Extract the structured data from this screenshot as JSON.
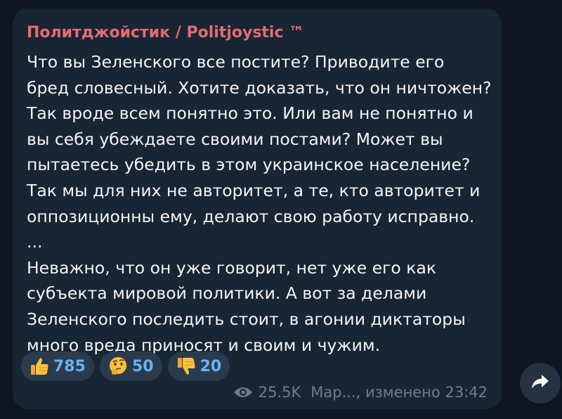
{
  "message": {
    "author": "Политджойстик / Politjoystic ™",
    "lines": [
      "Что вы Зеленского все постите? Приводите его",
      "бред словесный. Хотите доказать, что он ничтожен?",
      "Так вроде всем понятно это. Или вам не понятно и",
      "вы себя убеждаете своими постами? Может вы",
      "пытаетесь убедить в этом украинское население?",
      "Так мы для них не авторитет, а те, кто авторитет и",
      "оппозиционны ему, делают свою работу исправно.",
      "...",
      "Неважно, что он уже говорит, нет уже его как",
      "субъекта мировой политики. А вот за делами",
      "Зеленского последить стоит, в агонии диктаторы",
      "много вреда приносят и своим и чужим."
    ],
    "reactions": [
      {
        "icon": "thumbs-up-icon",
        "count": "785"
      },
      {
        "icon": "thinking-face-icon",
        "count": "50"
      },
      {
        "icon": "thumbs-down-icon",
        "count": "20"
      }
    ],
    "views": "25.5K",
    "footer_text": "Мар..., изменено 23:42"
  },
  "colors": {
    "author": "#e56c73",
    "reaction_count": "#6ab2f2",
    "bubble": "#182533",
    "background": "#0e1621"
  },
  "share_icon": "share-arrow-icon"
}
